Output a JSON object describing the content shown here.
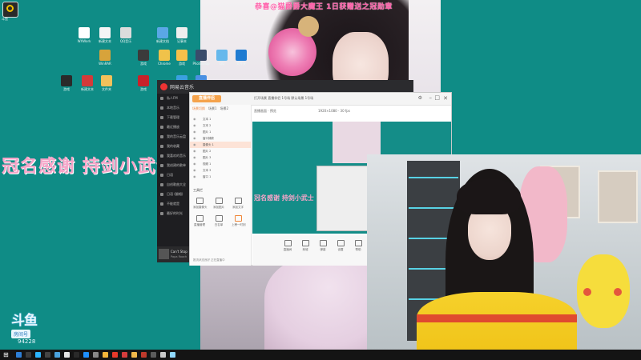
{
  "top_overlay_title": "恭喜@猫爵爵大魔王 1日获赠送之冠勋章",
  "left_banner": "冠名感谢 持剑小武士",
  "top_left_app": {
    "label": "斗鱼"
  },
  "desktop_icons": [
    {
      "label": "WXWork",
      "color": "#ffffff"
    },
    {
      "label": "新建文本",
      "color": "#f5f5f5"
    },
    {
      "label": "QQ音乐",
      "color": "#dcdcdc"
    },
    {
      "label": "新建文档",
      "color": "#5aa7e6"
    },
    {
      "label": "记事本",
      "color": "#eeeeee"
    },
    {
      "label": "WinRAR",
      "color": "#d7a33b"
    },
    {
      "label": "游戏",
      "color": "#3b3b3b"
    },
    {
      "label": "Chrome",
      "color": "#f0c24a"
    },
    {
      "label": "游戏",
      "color": "#f7c04a"
    },
    {
      "label": "Photoshop",
      "color": "#3a4c6b"
    },
    {
      "label": "QQ",
      "color": "#65b8ec"
    },
    {
      "label": "文件夹",
      "color": "#1f7bd1"
    },
    {
      "label": "游戏",
      "color": "#2a2a2a"
    },
    {
      "label": "新建文本",
      "color": "#d43a3a"
    },
    {
      "label": "文件夹",
      "color": "#f3c15b"
    },
    {
      "label": "游戏",
      "color": "#c8222a"
    },
    {
      "label": "工具",
      "color": "#3aa0e0"
    },
    {
      "label": "工具",
      "color": "#4a90e2"
    }
  ],
  "music_window": {
    "title": "网易云音乐",
    "nav": [
      "私人FM",
      "本地音乐",
      "下载管理",
      "最近播放",
      "我的音乐云盘",
      "我的收藏",
      "我喜欢的音乐",
      "我创建的歌单",
      "日语",
      "自创歌曲大全",
      "日语 (翻唱)",
      "不能就是",
      "最好的时光"
    ],
    "footer_track": "Can't Stop",
    "footer_artist": "Papa Roach"
  },
  "live_window": {
    "logo_text": "直播伴侣",
    "tabs": [
      "场景切换",
      "场景1",
      "场景2"
    ],
    "header_right": "打开场景 直播伴侣 1号场 默认场景 1号场",
    "sources": [
      "文本 1",
      "文本 2",
      "图片 1",
      "窗口捕获",
      "摄像头 1",
      "图片 2",
      "图片 3",
      "视频 1",
      "文本 3",
      "窗口 1"
    ],
    "section_label": "工具栏",
    "tools": [
      {
        "label": "添加摄像头"
      },
      {
        "label": "添加图片"
      },
      {
        "label": "添加文字"
      },
      {
        "label": "直播管理"
      },
      {
        "label": "白名单"
      },
      {
        "label": "上榜一时刻"
      }
    ],
    "stage_label": "直播画面 · 预览",
    "stage_resolution": "1920×1080 · 30 fps",
    "stage_banner": "冠名感谢 持剑小武士",
    "bottom_tools": [
      "直播间",
      "商城",
      "弹幕",
      "设置",
      "帮助"
    ],
    "status": "推流状态良好 正在直播中"
  },
  "douyu": {
    "brand": "斗鱼",
    "room_label": "房间号",
    "room_number": "94228"
  },
  "taskbar_colors": [
    "#2d7fd7",
    "#3b3b3b",
    "#2bb5ff",
    "#444",
    "#4aa3df",
    "#e6e6e6",
    "#2a2a2a",
    "#1e90ff",
    "#888",
    "#f5b53a",
    "#e8392a",
    "#d63c3c",
    "#f0b84a",
    "#c0392b",
    "#5c5c5c",
    "#c9c9c9",
    "#8fd8ff"
  ]
}
